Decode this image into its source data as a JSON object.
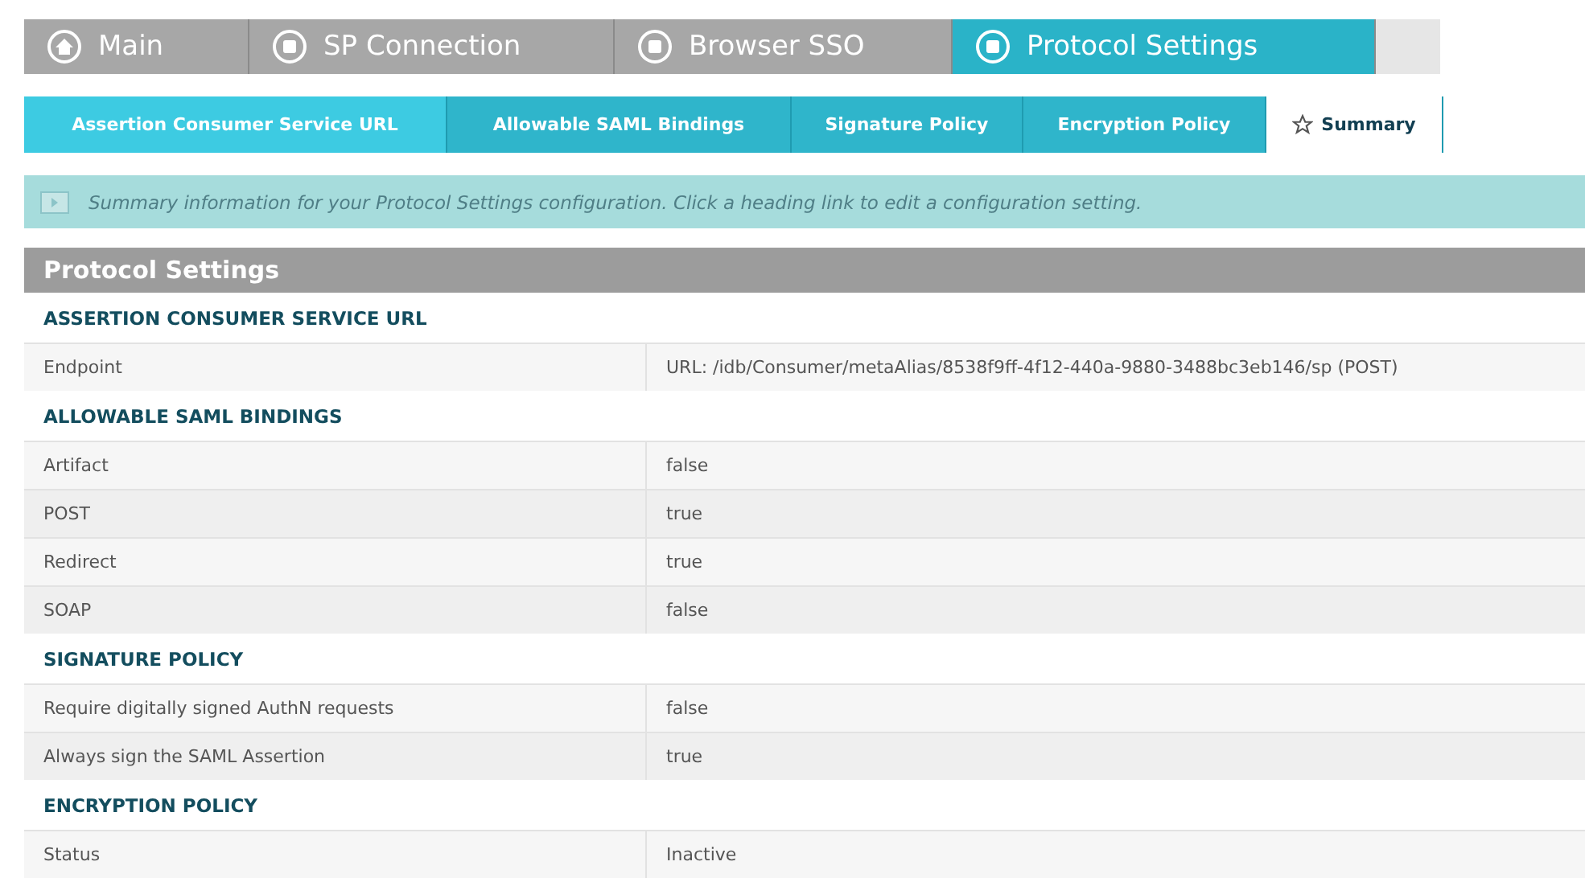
{
  "main_tabs": [
    {
      "label": "Main",
      "kind": "home",
      "selected": false
    },
    {
      "label": "SP Connection",
      "kind": "step",
      "selected": false
    },
    {
      "label": "Browser SSO",
      "kind": "step",
      "selected": false
    },
    {
      "label": "Protocol Settings",
      "kind": "step",
      "selected": true
    }
  ],
  "sub_tabs": [
    {
      "label": "Assertion Consumer Service URL",
      "kind": "plain",
      "selected": false
    },
    {
      "label": "Allowable SAML Bindings",
      "kind": "plain",
      "selected": false
    },
    {
      "label": "Signature Policy",
      "kind": "plain",
      "selected": false
    },
    {
      "label": "Encryption Policy",
      "kind": "plain",
      "selected": false
    },
    {
      "label": "Summary",
      "kind": "star",
      "selected": true
    }
  ],
  "info": "Summary information for your Protocol Settings configuration. Click a heading link to edit a configuration setting.",
  "panel_title": "Protocol Settings",
  "sections": [
    {
      "heading": "ASSERTION CONSUMER SERVICE URL",
      "rows": [
        {
          "label": "Endpoint",
          "value": "URL: /idb/Consumer/metaAlias/8538f9ff-4f12-440a-9880-3488bc3eb146/sp (POST)"
        }
      ]
    },
    {
      "heading": "ALLOWABLE SAML BINDINGS",
      "rows": [
        {
          "label": "Artifact",
          "value": "false"
        },
        {
          "label": "POST",
          "value": "true"
        },
        {
          "label": "Redirect",
          "value": "true"
        },
        {
          "label": "SOAP",
          "value": "false"
        }
      ]
    },
    {
      "heading": "SIGNATURE POLICY",
      "rows": [
        {
          "label": "Require digitally signed AuthN requests",
          "value": "false"
        },
        {
          "label": "Always sign the SAML Assertion",
          "value": "true"
        }
      ]
    },
    {
      "heading": "ENCRYPTION POLICY",
      "rows": [
        {
          "label": "Status",
          "value": "Inactive"
        }
      ]
    }
  ]
}
